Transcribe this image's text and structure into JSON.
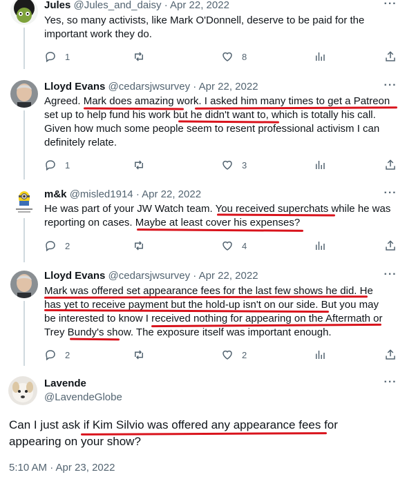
{
  "tweets": [
    {
      "name": "Jules",
      "handle": "@Jules_and_daisy",
      "date": "· Apr 22, 2022",
      "lines": [
        "Yes, so many activists, like Mark O'Donnell, deserve to be paid for the",
        "important work they do."
      ],
      "replies": "1",
      "retweets": "",
      "likes": "8"
    },
    {
      "name": "Lloyd Evans",
      "handle": "@cedarsjwsurvey",
      "date": "· Apr 22, 2022",
      "lines": [
        "Agreed. Mark does amazing work. I asked him many times to get a Patreon",
        "set up to help fund his work but he didn't want to, which is totally his call.",
        "Given how much some people seem to resent professional activism I can",
        "definitely relate."
      ],
      "replies": "1",
      "retweets": "",
      "likes": "3"
    },
    {
      "name": "m&k",
      "handle": "@misled1914",
      "date": "· Apr 22, 2022",
      "lines": [
        "He was part of your JW Watch team. You received superchats while he was",
        "reporting on cases. Maybe at least cover his expenses?"
      ],
      "replies": "2",
      "retweets": "",
      "likes": "4"
    },
    {
      "name": "Lloyd Evans",
      "handle": "@cedarsjwsurvey",
      "date": "· Apr 22, 2022",
      "lines": [
        "Mark was offered set appearance fees for the last few shows he did. He",
        "has yet to receive payment but the hold-up isn't on our side. But you may",
        "be interested to know I received nothing for appearing on the Aftermath or",
        "Trey Bundy's show. The exposure itself was important enough."
      ],
      "replies": "2",
      "retweets": "",
      "likes": "2"
    }
  ],
  "main_tweet": {
    "name": "Lavende",
    "handle": "@LavendeGlobe",
    "lines": [
      "Can I just ask if Kim Silvio was offered any appearance fees for",
      "appearing on your show?"
    ],
    "timestamp": "5:10 AM · Apr 23, 2022"
  },
  "icons": {
    "reply": "reply-icon",
    "retweet": "retweet-icon",
    "like": "heart-icon",
    "views": "views-icon",
    "share": "share-icon",
    "more": "more-icon"
  },
  "colors": {
    "underline": "#d9131c",
    "muted": "#536471",
    "text": "#0f1419",
    "thread_line": "#cfd9de"
  }
}
